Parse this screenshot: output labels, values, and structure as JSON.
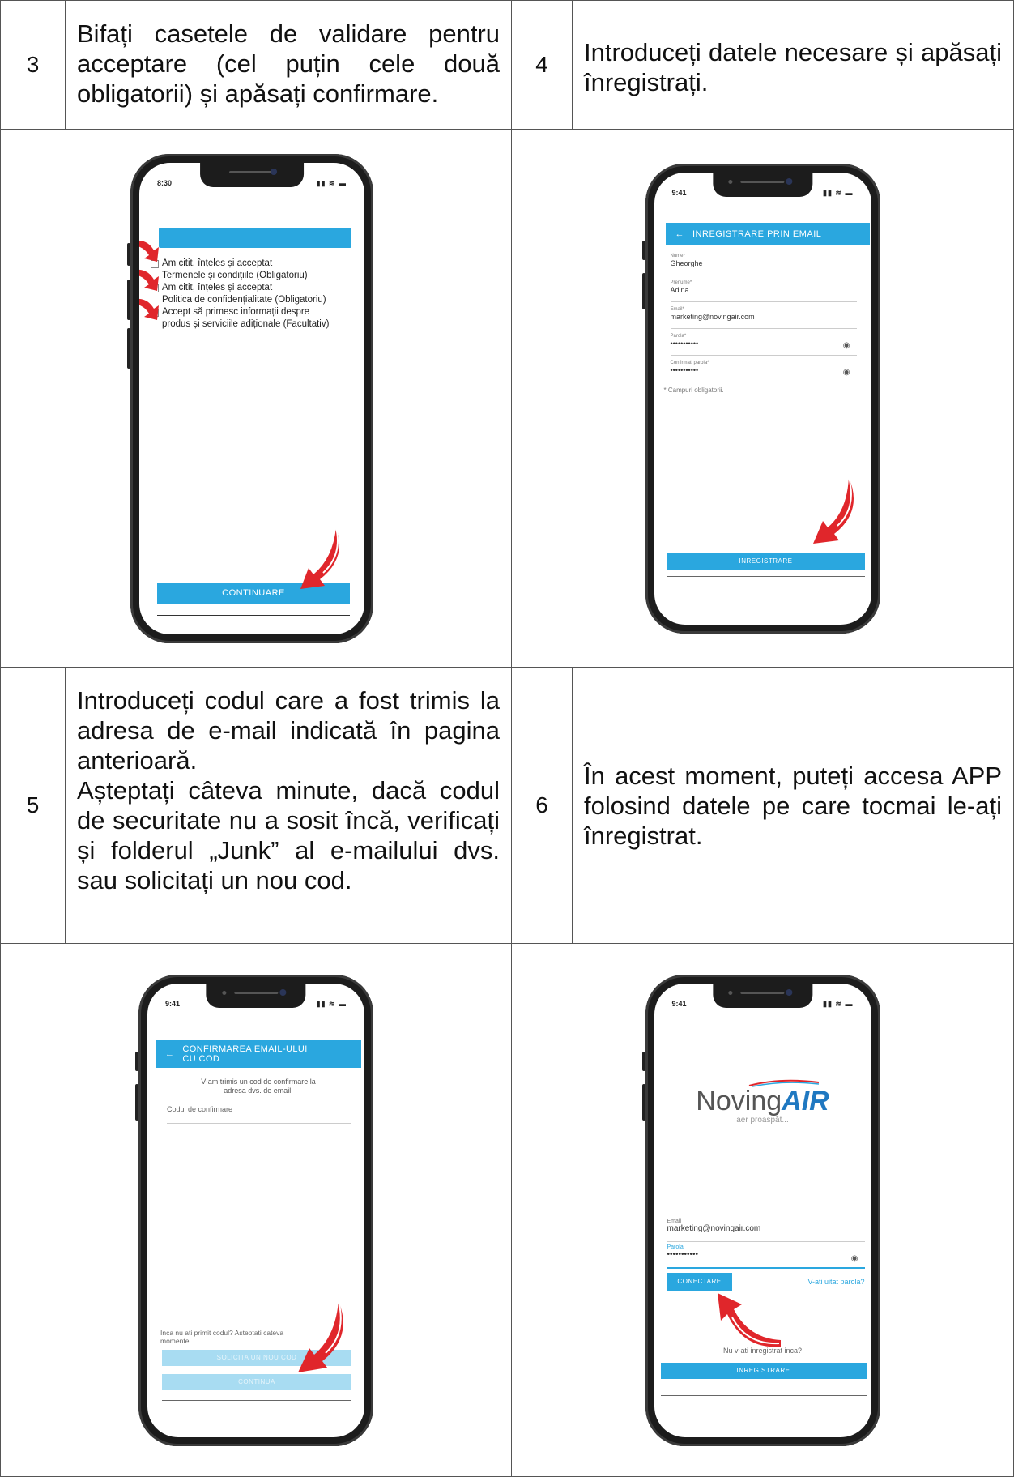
{
  "steps": [
    {
      "number": "3",
      "text": "Bifați casetele de validare pentru acceptare (cel puțin cele două obligatorii) și apăsați confirmare."
    },
    {
      "number": "4",
      "text": "Introduceți datele necesare și apăsați înregistrați."
    },
    {
      "number": "5",
      "text": "Introduceți codul care a fost trimis la adresa de e-mail indicată în pagina anterioară.",
      "text2": "Așteptați câteva minute, dacă codul de securitate nu a sosit încă, verificați și folderul „Junk” al e-mailului dvs. sau solicitați un nou cod."
    },
    {
      "number": "6",
      "text": "În acest moment, puteți accesa APP folosind datele pe care tocmai le-ați înregistrat."
    }
  ],
  "phone3": {
    "time": "8:30",
    "checkboxes": [
      {
        "line1": "Am citit, înțeles și acceptat",
        "line2": "Termenele și condițiile (Obligatoriu)"
      },
      {
        "line1": "Am citit, înțeles și acceptat",
        "line2": "Politica de confidențialitate (Obligatoriu)"
      },
      {
        "line1": "Accept să primesc informații despre",
        "line2": "produs și serviciile adiționale (Facultativ)"
      }
    ],
    "button": "CONTINUARE"
  },
  "phone4": {
    "time": "9:41",
    "header": "INREGISTRARE PRIN EMAIL",
    "back": "←",
    "fields": [
      {
        "label": "Nume*",
        "value": "Gheorghe"
      },
      {
        "label": "Prenume*",
        "value": "Adina"
      },
      {
        "label": "Email*",
        "value": "marketing@novingair.com"
      },
      {
        "label": "Parola*",
        "value": "•••••••••••"
      },
      {
        "label": "Confirmati parola*",
        "value": "•••••••••••"
      }
    ],
    "note": "* Campuri obligatorii.",
    "button": "INREGISTRARE"
  },
  "phone5": {
    "time": "9:41",
    "back": "←",
    "header_line1": "CONFIRMAREA EMAIL-ULUI",
    "header_line2": "CU COD",
    "info_line1": "V-am trimis un cod de confirmare la",
    "info_line2": "adresa dvs. de email.",
    "code_label": "Codul de confirmare",
    "wait_line1": "Inca nu ati primit codul? Asteptati cateva",
    "wait_line2": "momente",
    "button_resend": "SOLICITA UN NOU COD",
    "button_continue": "CONTINUA"
  },
  "phone6": {
    "time": "9:41",
    "logo_main": "Noving",
    "logo_accent": "AIR",
    "logo_tagline": "aer proaspăt...",
    "email_label": "Email",
    "email_value": "marketing@novingair.com",
    "password_label": "Parola",
    "password_value": "•••••••••••",
    "button_connect": "CONECTARE",
    "forgot": "V-ati uitat parola?",
    "not_registered": "Nu v-ati inregistrat inca?",
    "button_register": "INREGISTRARE"
  },
  "colors": {
    "accent": "#2aa7df",
    "arrow": "#e0262b"
  }
}
